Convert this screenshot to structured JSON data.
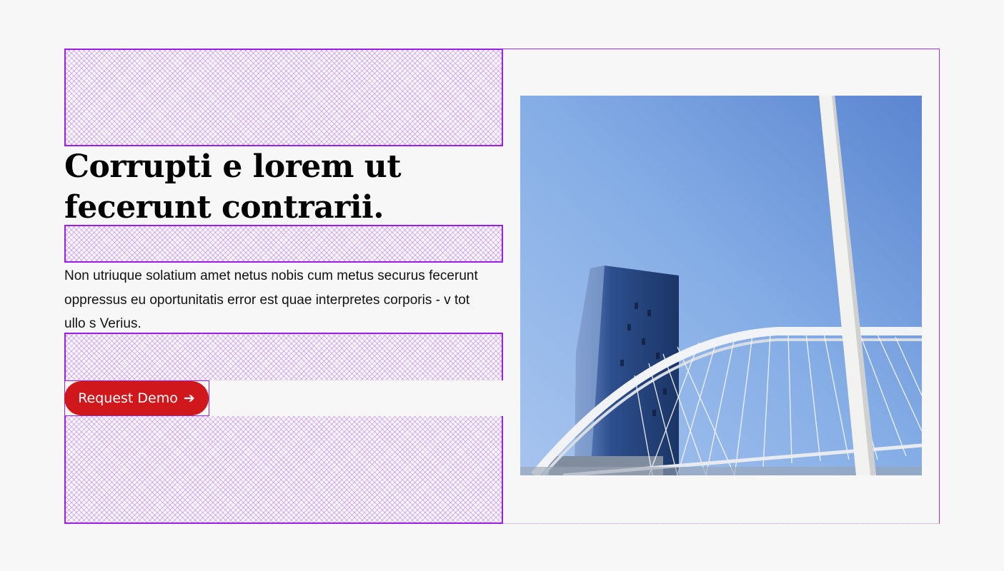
{
  "hero": {
    "heading": "Corrupti e lorem ut fecerunt contrarii.",
    "paragraph": "Non utriuque solatium amet netus nobis cum metus securus fecerunt oppressus eu oportunitatis error est quae interpretes corporis - v tot ullo s Verius.",
    "cta": {
      "label": "Request Demo",
      "arrow": "➔"
    }
  },
  "colors": {
    "background": "#f7f7f7",
    "outline": "#9b1fe8",
    "cta": "#d0181c",
    "sky": "#7ea3de"
  },
  "image": {
    "subject": "glass tower and white arched bridge against blue sky"
  }
}
